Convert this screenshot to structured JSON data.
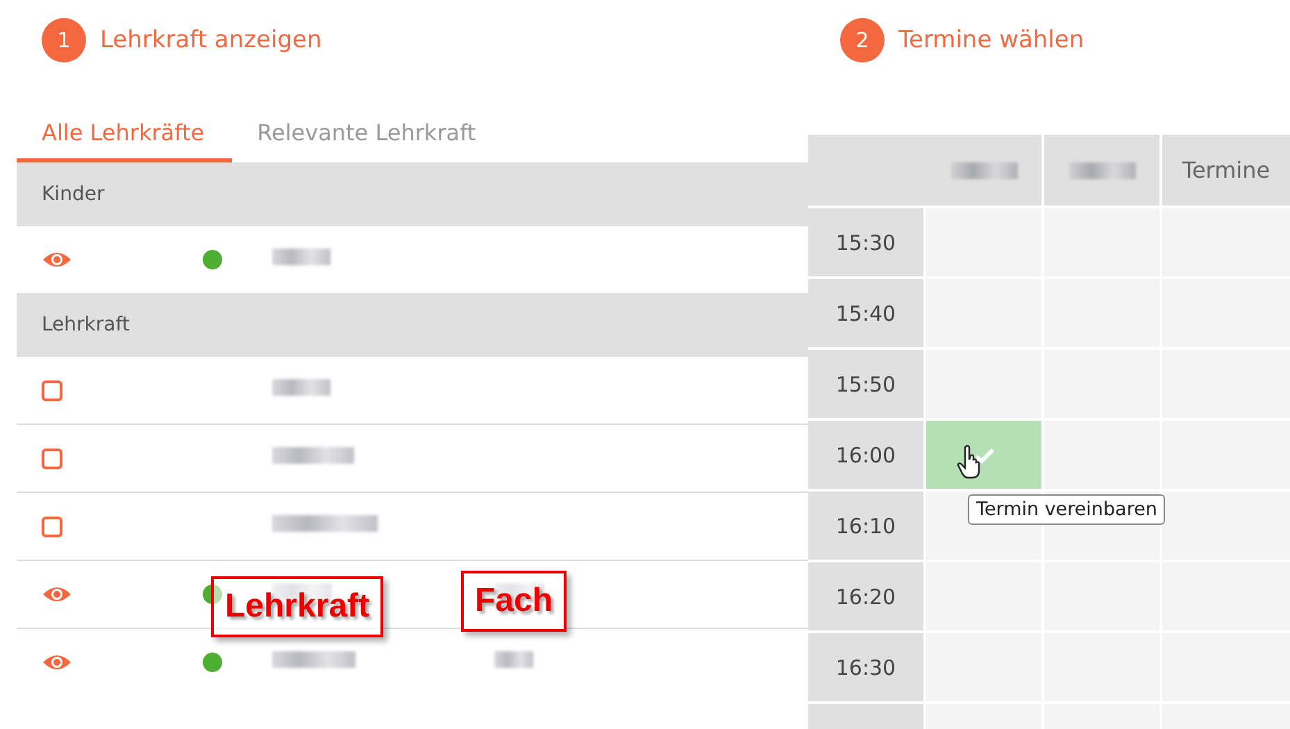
{
  "steps": [
    {
      "number": "1",
      "title": "Lehrkraft anzeigen"
    },
    {
      "number": "2",
      "title": "Termine wählen"
    }
  ],
  "tabs": [
    {
      "label": "Alle Lehrkräfte",
      "selected": true
    },
    {
      "label": "Relevante Lehrkraft",
      "selected": false
    }
  ],
  "groups": [
    {
      "title": "Kinder",
      "rows": [
        {
          "kind": "eye",
          "color": "#4caf32",
          "name_blurred": true,
          "subject_blurred": false
        }
      ]
    },
    {
      "title": "Lehrkraft",
      "rows": [
        {
          "kind": "checkbox",
          "checked": false,
          "name_blurred": true,
          "subject_blurred": false
        },
        {
          "kind": "checkbox",
          "checked": false,
          "name_blurred": true,
          "subject_blurred": false
        },
        {
          "kind": "checkbox",
          "checked": false,
          "name_blurred": true,
          "subject_blurred": false
        },
        {
          "kind": "eye",
          "color": "#4caf32",
          "name_blurred": true,
          "subject_blurred": true
        },
        {
          "kind": "eye",
          "color": "#4caf32",
          "name_blurred": true,
          "subject_blurred": true
        }
      ]
    }
  ],
  "annotations": [
    {
      "label": "Lehrkraft"
    },
    {
      "label": "Fach"
    }
  ],
  "schedule": {
    "columns": [
      {
        "blurred": true
      },
      {
        "blurred": true
      },
      {
        "label": "Termine"
      }
    ],
    "rows": [
      {
        "time": "15:30",
        "cells": [
          {
            "selected": false
          },
          {
            "selected": false
          },
          {
            "selected": false
          }
        ]
      },
      {
        "time": "15:40",
        "cells": [
          {
            "selected": false
          },
          {
            "selected": false
          },
          {
            "selected": false
          }
        ]
      },
      {
        "time": "15:50",
        "cells": [
          {
            "selected": false
          },
          {
            "selected": false
          },
          {
            "selected": false
          }
        ]
      },
      {
        "time": "16:00",
        "cells": [
          {
            "selected": true
          },
          {
            "selected": false
          },
          {
            "selected": false
          }
        ]
      },
      {
        "time": "16:10",
        "cells": [
          {
            "selected": false
          },
          {
            "selected": false
          },
          {
            "selected": false
          }
        ]
      },
      {
        "time": "16:20",
        "cells": [
          {
            "selected": false
          },
          {
            "selected": false
          },
          {
            "selected": false
          }
        ]
      },
      {
        "time": "16:30",
        "cells": [
          {
            "selected": false
          },
          {
            "selected": false
          },
          {
            "selected": false
          }
        ]
      }
    ],
    "tooltip": "Termin vereinbaren"
  }
}
